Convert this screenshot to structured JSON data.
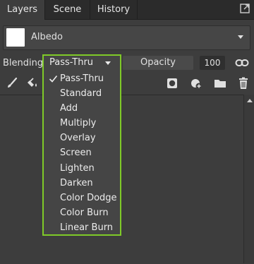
{
  "tabs": [
    {
      "label": "Layers",
      "active": true
    },
    {
      "label": "Scene",
      "active": false
    },
    {
      "label": "History",
      "active": false
    }
  ],
  "albedo": {
    "label": "Albedo",
    "swatch_color": "#ffffff"
  },
  "blending": {
    "label": "Blending",
    "selected": "Pass-Thru",
    "options": [
      "Pass-Thru",
      "Standard",
      "Add",
      "Multiply",
      "Overlay",
      "Screen",
      "Lighten",
      "Darken",
      "Color Dodge",
      "Color Burn",
      "Linear Burn"
    ]
  },
  "opacity": {
    "label": "Opacity",
    "value": "100"
  },
  "toolbar_icons": [
    "paint-brush-icon",
    "fill-bucket-icon",
    "mask-icon",
    "add-effect-icon",
    "folder-icon",
    "trash-icon"
  ],
  "colors": {
    "accent_outline": "#7fca28"
  }
}
